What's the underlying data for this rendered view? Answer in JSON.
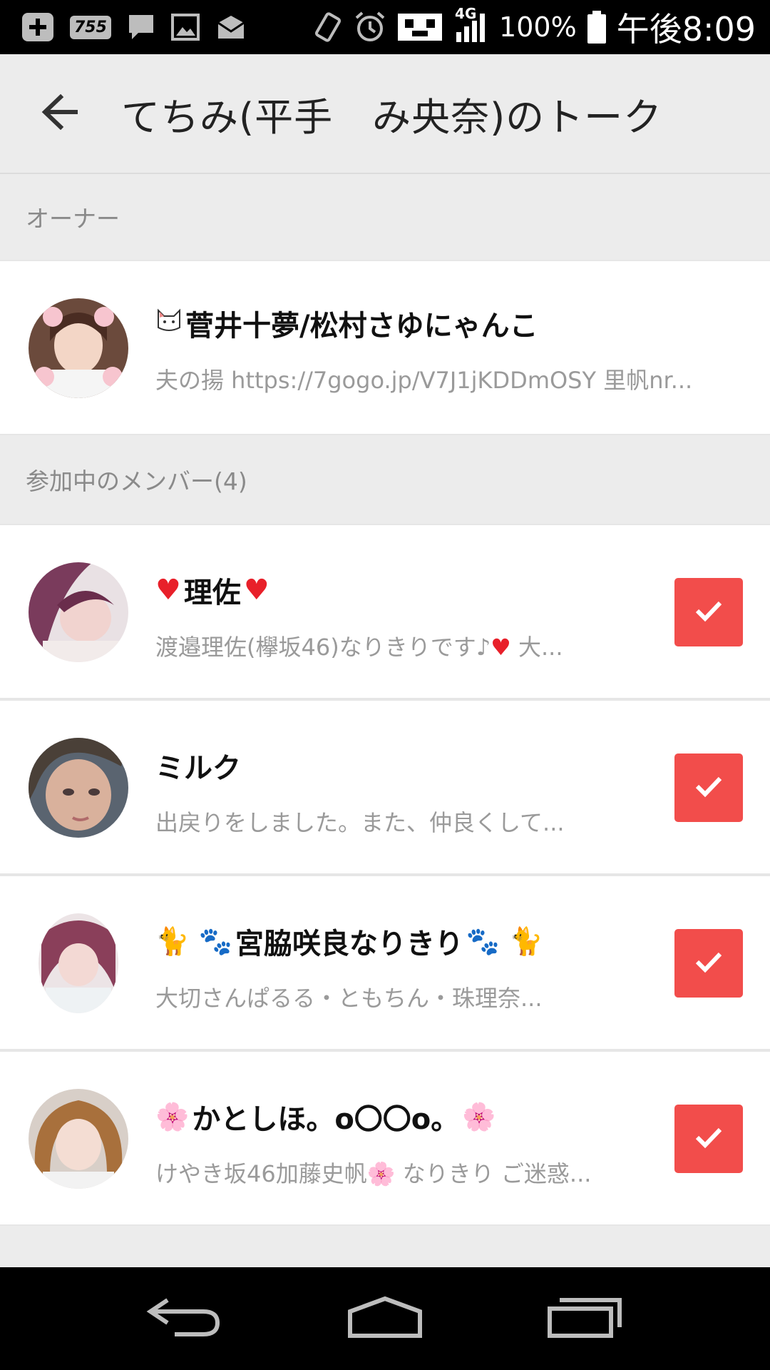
{
  "status_bar": {
    "badge_755": "755",
    "network": "4G",
    "battery": "100%",
    "time": "午後8:09",
    "icons": [
      "plus-square-icon",
      "755-app-icon",
      "chat-bubble-icon",
      "image-icon",
      "mail-icon",
      "vibrate-icon",
      "alarm-icon",
      "sim-icon",
      "signal-icon",
      "battery-icon"
    ]
  },
  "appbar": {
    "title": "てちみ(平手　み央奈)のトーク",
    "back_icon": "arrow-left-icon"
  },
  "owner_section": {
    "header": "オーナー",
    "owner": {
      "prefix_icon": "cat-face-icon",
      "name": "菅井十夢/松村さゆにゃんこ",
      "message": "夫の揚 https://7gogo.jp/V7J1jKDDmOSY 里帆nr..."
    }
  },
  "members_section": {
    "header": "参加中のメンバー(4)",
    "members": [
      {
        "name_prefix": "♥",
        "name": "理佐",
        "name_suffix": "♥",
        "message": "渡邉理佐(欅坂46)なりきりです♪",
        "message_heart": "♥",
        "message_tail": " 大...",
        "checked": true
      },
      {
        "name_prefix": "",
        "name": "ミルク",
        "name_suffix": "",
        "message": "出戻りをしました。また、仲良くして...",
        "message_heart": "",
        "message_tail": "",
        "checked": true
      },
      {
        "name_prefix": "🐈 🐾",
        "name": "宮脇咲良なりきり",
        "name_suffix": "🐾 🐈",
        "message": "大切さんぱるる・ともちん・珠理奈...",
        "message_heart": "",
        "message_tail": "",
        "checked": true
      },
      {
        "name_prefix": "🌸",
        "name": "かとしほ。o〇〇o。",
        "name_suffix": "🌸",
        "message": "けやき坂46加藤史帆",
        "message_heart": "🌸",
        "message_tail": " なりきり ご迷惑...",
        "checked": true
      }
    ]
  },
  "colors": {
    "accent": "#f24d4b",
    "background": "#ececec",
    "row_bg": "#ffffff",
    "heart": "#e8202a"
  }
}
